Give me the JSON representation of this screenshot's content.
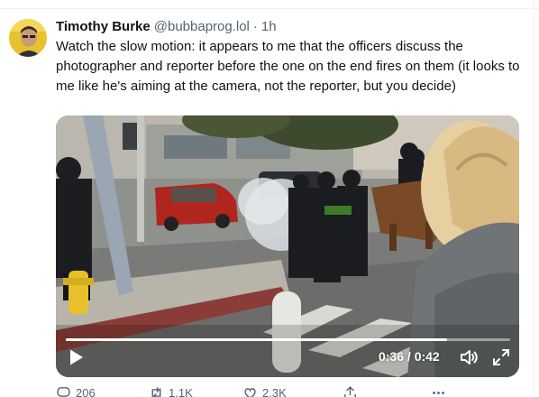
{
  "tweet": {
    "display_name": "Timothy Burke",
    "handle": "@bubbaprog.lol",
    "separator": "·",
    "time": "1h",
    "text": "Watch the slow motion: it appears to me that the officers discuss the photographer and reporter before the one on the end fires on them (it looks to me like he's aiming at the camera, not the reporter, but you decide)"
  },
  "video": {
    "time_readout": "0:36 / 0:42",
    "progress_fraction": 0.857,
    "play_icon": "play-icon",
    "volume_icon": "volume-icon",
    "fullscreen_icon": "fullscreen-icon"
  },
  "actions": {
    "replies": "206",
    "reposts": "1.1K",
    "likes": "2.3K",
    "reply_icon": "reply-icon",
    "repost_icon": "repost-icon",
    "like_icon": "heart-icon",
    "share_icon": "share-icon",
    "more_icon": "more-icon"
  },
  "colors": {
    "text": "#0f1419",
    "secondary": "#536471"
  }
}
